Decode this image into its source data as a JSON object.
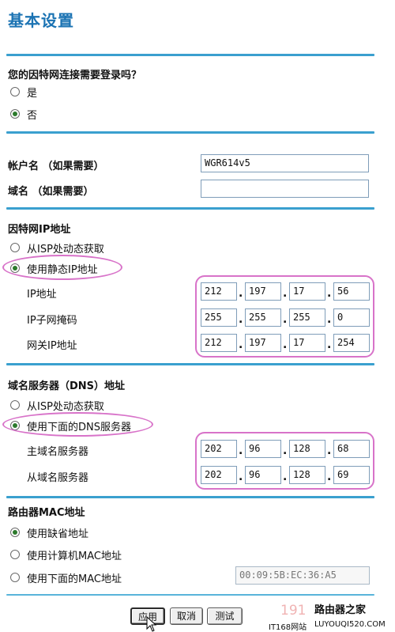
{
  "page": {
    "title": "基本设置"
  },
  "login": {
    "heading": "您的因特网连接需要登录吗？",
    "options": [
      {
        "label": "是",
        "checked": false
      },
      {
        "label": "否",
        "checked": true
      }
    ]
  },
  "account": {
    "name_label": "帐户名 （如果需要）",
    "name_value": "WGR614v5",
    "domain_label": "域名 （如果需要）",
    "domain_value": ""
  },
  "ip": {
    "heading": "因特网IP地址",
    "options": [
      {
        "label": "从ISP处动态获取",
        "checked": false
      },
      {
        "label": "使用静态IP地址",
        "checked": true
      }
    ],
    "rows": [
      {
        "label": "IP地址",
        "octets": [
          "212",
          "197",
          "17",
          "56"
        ]
      },
      {
        "label": "IP子网掩码",
        "octets": [
          "255",
          "255",
          "255",
          "0"
        ]
      },
      {
        "label": "网关IP地址",
        "octets": [
          "212",
          "197",
          "17",
          "254"
        ]
      }
    ]
  },
  "dns": {
    "heading": "域名服务器（DNS）地址",
    "options": [
      {
        "label": "从ISP处动态获取",
        "checked": false
      },
      {
        "label": "使用下面的DNS服务器",
        "checked": true
      }
    ],
    "rows": [
      {
        "label": "主域名服务器",
        "octets": [
          "202",
          "96",
          "128",
          "68"
        ]
      },
      {
        "label": "从域名服务器",
        "octets": [
          "202",
          "96",
          "128",
          "69"
        ]
      }
    ]
  },
  "mac": {
    "heading": "路由器MAC地址",
    "options": [
      {
        "label": "使用缺省地址",
        "checked": true
      },
      {
        "label": "使用计算机MAC地址",
        "checked": false
      },
      {
        "label": "使用下面的MAC地址",
        "checked": false
      }
    ],
    "value": "00:09:5B:EC:36:A5"
  },
  "buttons": {
    "apply": "应用",
    "cancel": "取消",
    "test": "测试"
  },
  "watermark": {
    "brand": "路由器之家",
    "left_text": "IT168网站",
    "url": "LUYOUQI520.COM",
    "faint": "191"
  },
  "colors": {
    "title": "#1b73b3",
    "rule": "#3aa0cf",
    "highlight": "#d873c9",
    "radio_dot": "#2c7a2c"
  }
}
